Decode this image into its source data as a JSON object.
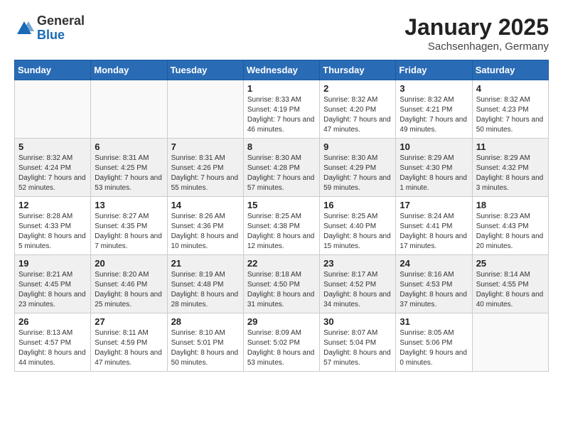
{
  "logo": {
    "general": "General",
    "blue": "Blue"
  },
  "title": "January 2025",
  "location": "Sachsenhagen, Germany",
  "days_of_week": [
    "Sunday",
    "Monday",
    "Tuesday",
    "Wednesday",
    "Thursday",
    "Friday",
    "Saturday"
  ],
  "weeks": [
    [
      {
        "day": "",
        "info": ""
      },
      {
        "day": "",
        "info": ""
      },
      {
        "day": "",
        "info": ""
      },
      {
        "day": "1",
        "info": "Sunrise: 8:33 AM\nSunset: 4:19 PM\nDaylight: 7 hours and 46 minutes."
      },
      {
        "day": "2",
        "info": "Sunrise: 8:32 AM\nSunset: 4:20 PM\nDaylight: 7 hours and 47 minutes."
      },
      {
        "day": "3",
        "info": "Sunrise: 8:32 AM\nSunset: 4:21 PM\nDaylight: 7 hours and 49 minutes."
      },
      {
        "day": "4",
        "info": "Sunrise: 8:32 AM\nSunset: 4:23 PM\nDaylight: 7 hours and 50 minutes."
      }
    ],
    [
      {
        "day": "5",
        "info": "Sunrise: 8:32 AM\nSunset: 4:24 PM\nDaylight: 7 hours and 52 minutes."
      },
      {
        "day": "6",
        "info": "Sunrise: 8:31 AM\nSunset: 4:25 PM\nDaylight: 7 hours and 53 minutes."
      },
      {
        "day": "7",
        "info": "Sunrise: 8:31 AM\nSunset: 4:26 PM\nDaylight: 7 hours and 55 minutes."
      },
      {
        "day": "8",
        "info": "Sunrise: 8:30 AM\nSunset: 4:28 PM\nDaylight: 7 hours and 57 minutes."
      },
      {
        "day": "9",
        "info": "Sunrise: 8:30 AM\nSunset: 4:29 PM\nDaylight: 7 hours and 59 minutes."
      },
      {
        "day": "10",
        "info": "Sunrise: 8:29 AM\nSunset: 4:30 PM\nDaylight: 8 hours and 1 minute."
      },
      {
        "day": "11",
        "info": "Sunrise: 8:29 AM\nSunset: 4:32 PM\nDaylight: 8 hours and 3 minutes."
      }
    ],
    [
      {
        "day": "12",
        "info": "Sunrise: 8:28 AM\nSunset: 4:33 PM\nDaylight: 8 hours and 5 minutes."
      },
      {
        "day": "13",
        "info": "Sunrise: 8:27 AM\nSunset: 4:35 PM\nDaylight: 8 hours and 7 minutes."
      },
      {
        "day": "14",
        "info": "Sunrise: 8:26 AM\nSunset: 4:36 PM\nDaylight: 8 hours and 10 minutes."
      },
      {
        "day": "15",
        "info": "Sunrise: 8:25 AM\nSunset: 4:38 PM\nDaylight: 8 hours and 12 minutes."
      },
      {
        "day": "16",
        "info": "Sunrise: 8:25 AM\nSunset: 4:40 PM\nDaylight: 8 hours and 15 minutes."
      },
      {
        "day": "17",
        "info": "Sunrise: 8:24 AM\nSunset: 4:41 PM\nDaylight: 8 hours and 17 minutes."
      },
      {
        "day": "18",
        "info": "Sunrise: 8:23 AM\nSunset: 4:43 PM\nDaylight: 8 hours and 20 minutes."
      }
    ],
    [
      {
        "day": "19",
        "info": "Sunrise: 8:21 AM\nSunset: 4:45 PM\nDaylight: 8 hours and 23 minutes."
      },
      {
        "day": "20",
        "info": "Sunrise: 8:20 AM\nSunset: 4:46 PM\nDaylight: 8 hours and 25 minutes."
      },
      {
        "day": "21",
        "info": "Sunrise: 8:19 AM\nSunset: 4:48 PM\nDaylight: 8 hours and 28 minutes."
      },
      {
        "day": "22",
        "info": "Sunrise: 8:18 AM\nSunset: 4:50 PM\nDaylight: 8 hours and 31 minutes."
      },
      {
        "day": "23",
        "info": "Sunrise: 8:17 AM\nSunset: 4:52 PM\nDaylight: 8 hours and 34 minutes."
      },
      {
        "day": "24",
        "info": "Sunrise: 8:16 AM\nSunset: 4:53 PM\nDaylight: 8 hours and 37 minutes."
      },
      {
        "day": "25",
        "info": "Sunrise: 8:14 AM\nSunset: 4:55 PM\nDaylight: 8 hours and 40 minutes."
      }
    ],
    [
      {
        "day": "26",
        "info": "Sunrise: 8:13 AM\nSunset: 4:57 PM\nDaylight: 8 hours and 44 minutes."
      },
      {
        "day": "27",
        "info": "Sunrise: 8:11 AM\nSunset: 4:59 PM\nDaylight: 8 hours and 47 minutes."
      },
      {
        "day": "28",
        "info": "Sunrise: 8:10 AM\nSunset: 5:01 PM\nDaylight: 8 hours and 50 minutes."
      },
      {
        "day": "29",
        "info": "Sunrise: 8:09 AM\nSunset: 5:02 PM\nDaylight: 8 hours and 53 minutes."
      },
      {
        "day": "30",
        "info": "Sunrise: 8:07 AM\nSunset: 5:04 PM\nDaylight: 8 hours and 57 minutes."
      },
      {
        "day": "31",
        "info": "Sunrise: 8:05 AM\nSunset: 5:06 PM\nDaylight: 9 hours and 0 minutes."
      },
      {
        "day": "",
        "info": ""
      }
    ]
  ]
}
